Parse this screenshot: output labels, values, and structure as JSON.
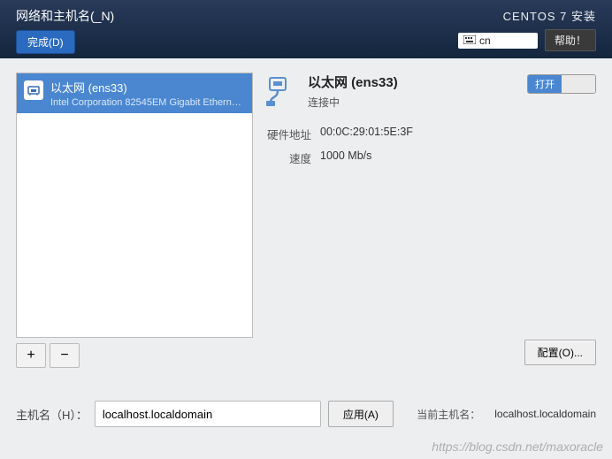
{
  "header": {
    "page_title": "网络和主机名(_N)",
    "done_button": "完成(D)",
    "installer_title": "CENTOS 7 安装",
    "lang_indicator": "cn",
    "help_button": "帮助！"
  },
  "interface_list": {
    "items": [
      {
        "name": "以太网 (ens33)",
        "description": "Intel Corporation 82545EM Gigabit Ethernet Controller (…"
      }
    ],
    "add_button": "+",
    "remove_button": "−"
  },
  "detail": {
    "title": "以太网 (ens33)",
    "status": "连接中",
    "toggle_on_label": "打开",
    "toggle_off_label": "",
    "props": [
      {
        "label": "硬件地址",
        "value": "00:0C:29:01:5E:3F"
      },
      {
        "label": "速度",
        "value": "1000 Mb/s"
      }
    ],
    "configure_button": "配置(O)..."
  },
  "hostname": {
    "label": "主机名（H）：",
    "value": "localhost.localdomain",
    "apply_button": "应用(A)",
    "current_label": "当前主机名：",
    "current_value": "localhost.localdomain"
  },
  "watermark": "https://blog.csdn.net/maxoracle"
}
